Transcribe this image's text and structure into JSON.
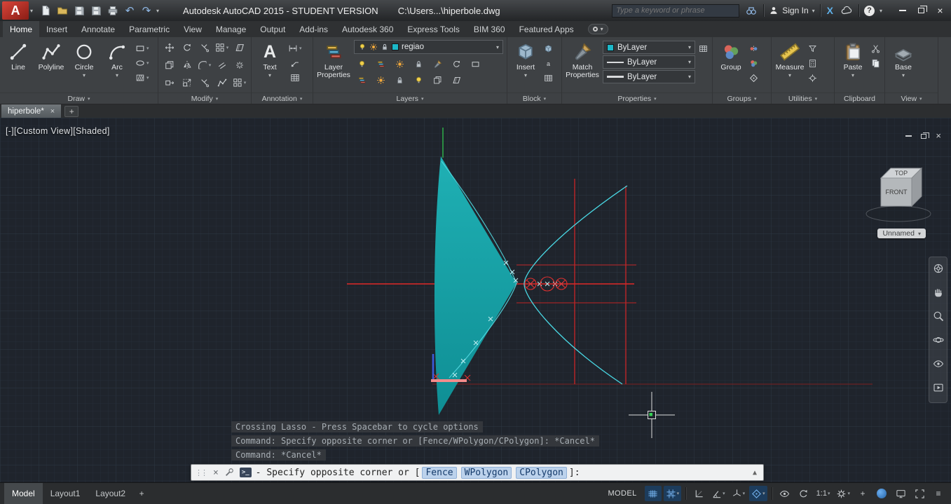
{
  "colors": {
    "cone_teal": "#14a0a8",
    "axis_red": "#e02828",
    "curve_cyan": "#49d6e2",
    "axis_green": "#2fae4a",
    "layer_swatch_cyan": "#1cb8c8",
    "status_active_blue": "#2f7bd1"
  },
  "icons": {
    "logo_a": "A",
    "caret_down": "▾",
    "close": "×",
    "menu": "≡",
    "undo": "↶",
    "redo": "↷",
    "plus": "+",
    "help": "?",
    "exchange_x": "X",
    "up_arrow": "▲",
    "prompt": ">_",
    "grip": "⋮⋮",
    "text_tool": "A"
  },
  "titlebar": {
    "title": "Autodesk AutoCAD 2015 - STUDENT VERSION",
    "doc_path": "C:\\Users...\\hiperbole.dwg",
    "search_placeholder": "Type a keyword or phrase",
    "sign_in": "Sign In"
  },
  "ribbon_tabs": [
    "Home",
    "Insert",
    "Annotate",
    "Parametric",
    "View",
    "Manage",
    "Output",
    "Add-ins",
    "Autodesk 360",
    "Express Tools",
    "BIM 360",
    "Featured Apps"
  ],
  "panels": {
    "draw": {
      "label": "Draw",
      "line": "Line",
      "polyline": "Polyline",
      "circle": "Circle",
      "arc": "Arc"
    },
    "modify": {
      "label": "Modify"
    },
    "annotation": {
      "label": "Annotation",
      "text": "Text"
    },
    "layers": {
      "label": "Layers",
      "layer_properties": "Layer Properties",
      "current_layer": "regiao"
    },
    "block": {
      "label": "Block",
      "insert": "Insert"
    },
    "properties": {
      "label": "Properties",
      "match_properties": "Match Properties",
      "color": "ByLayer",
      "linetype": "ByLayer",
      "lineweight": "ByLayer"
    },
    "groups": {
      "label": "Groups",
      "group": "Group"
    },
    "utilities": {
      "label": "Utilities",
      "measure": "Measure"
    },
    "clipboard": {
      "label": "Clipboard",
      "paste": "Paste"
    },
    "view": {
      "label": "View",
      "base": "Base"
    }
  },
  "file_tabs": {
    "active": "hiperbole*"
  },
  "viewport": {
    "controls": "[-][Custom View][Shaded]",
    "viewcube_top": "TOP",
    "viewcube_front": "FRONT",
    "view_name": "Unnamed"
  },
  "command_history": [
    "Crossing Lasso - Press Spacebar to cycle options",
    "Command: Specify opposite corner or [Fence/WPolygon/CPolygon]: *Cancel*",
    "Command: *Cancel*"
  ],
  "command_line": {
    "marker": "-",
    "prompt_prefix": "Specify opposite corner or [",
    "options": [
      "Fence",
      "WPolygon",
      "CPolygon"
    ],
    "prompt_suffix": "]:"
  },
  "statusbar": {
    "tabs": [
      "Model",
      "Layout1",
      "Layout2"
    ],
    "model_button": "MODEL",
    "annotation_scale": "1:1"
  }
}
